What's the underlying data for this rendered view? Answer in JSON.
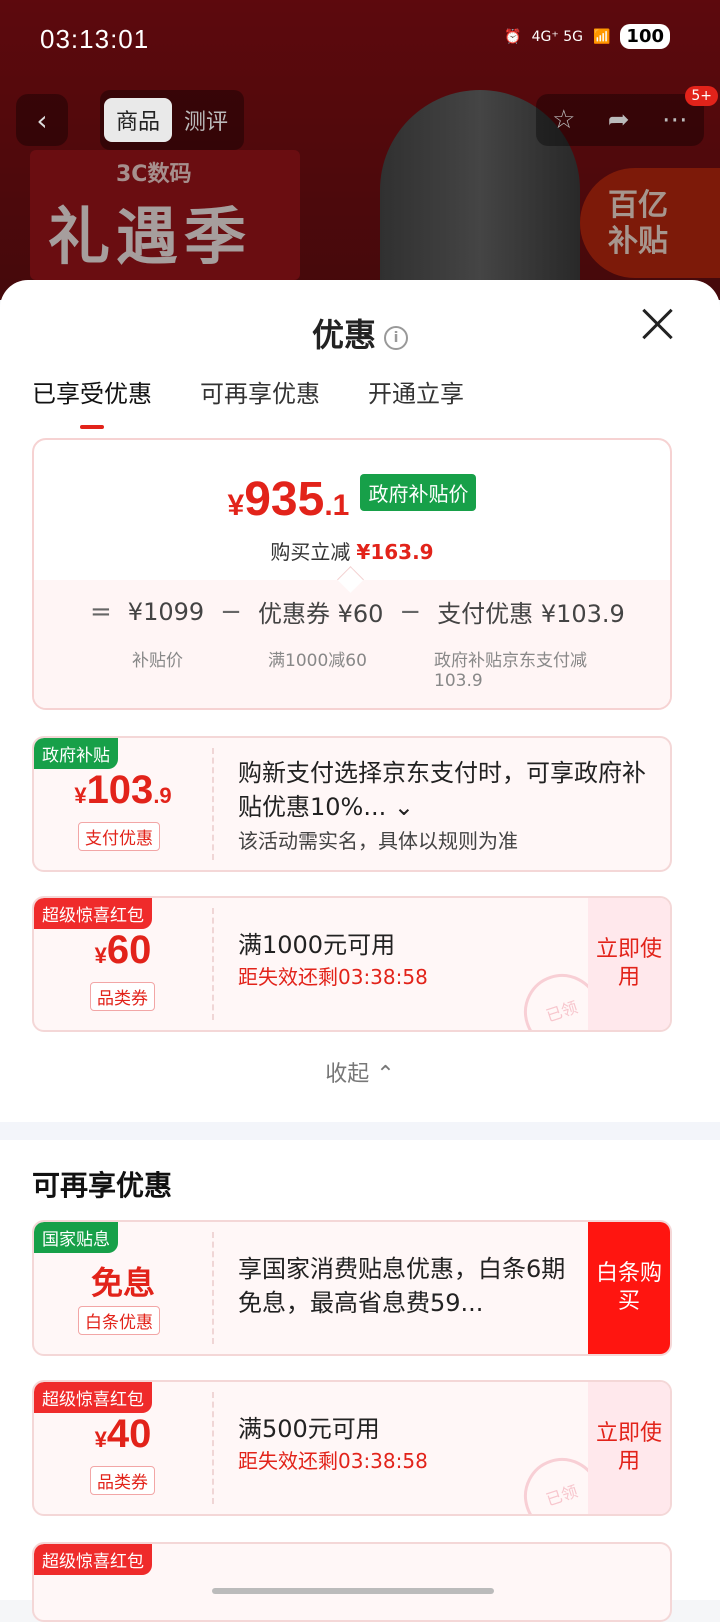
{
  "status_bar": {
    "time": "03:13:01",
    "network": "4G⁺ 5G",
    "battery": "100"
  },
  "product_header": {
    "tabs": [
      {
        "label": "商品",
        "active": true
      },
      {
        "label": "测评",
        "active": false
      }
    ],
    "cart_badge": "5+",
    "promo_small": "3C数码",
    "promo_big": "礼遇季",
    "subsidy_badge_line1": "百亿",
    "subsidy_badge_line2": "补贴"
  },
  "sheet": {
    "title": "优惠",
    "tabs": [
      {
        "label": "已享受优惠",
        "active": true
      },
      {
        "label": "可再享优惠",
        "active": false
      },
      {
        "label": "开通立享",
        "active": false
      }
    ],
    "summary": {
      "currency": "¥",
      "price_int": "935",
      "price_dec": ".1",
      "price_tag": "政府补贴价",
      "save_label": "购买立减",
      "save_value": "¥163.9",
      "calc": {
        "eq": "=",
        "base": "¥1099",
        "base_sub": "补贴价",
        "minus": "−",
        "coupon": "优惠券 ¥60",
        "coupon_sub": "满1000减60",
        "pay": "支付优惠 ¥103.9",
        "pay_sub": "政府补贴京东支付减103.9"
      }
    },
    "cards": [
      {
        "tag": "政府补贴",
        "currency": "¥",
        "amount": "103",
        "amount_dec": ".9",
        "type": "支付优惠",
        "text": "购新支付选择京东支付时，可享政府补贴优惠10%... ⌄",
        "sub": "该活动需实名，具体以规则为准"
      },
      {
        "tag": "超级惊喜红包",
        "currency": "¥",
        "amount": "60",
        "type": "品类券",
        "text": "满1000元可用",
        "countdown": "距失效还剩03:38:58",
        "action": "立即使用",
        "stamp": "已领"
      }
    ],
    "collapse_label": "收起 ⌃",
    "section_title": "可再享优惠",
    "more_cards": [
      {
        "tag": "国家贴息",
        "amount": "免息",
        "type": "白条优惠",
        "text": "享国家消费贴息优惠，白条6期免息，最高省息费59...",
        "action": "白条购买"
      },
      {
        "tag": "超级惊喜红包",
        "currency": "¥",
        "amount": "40",
        "type": "品类券",
        "text": "满500元可用",
        "countdown": "距失效还剩03:38:58",
        "action": "立即使用",
        "stamp": "已领"
      },
      {
        "tag": "超级惊喜红包"
      }
    ]
  }
}
